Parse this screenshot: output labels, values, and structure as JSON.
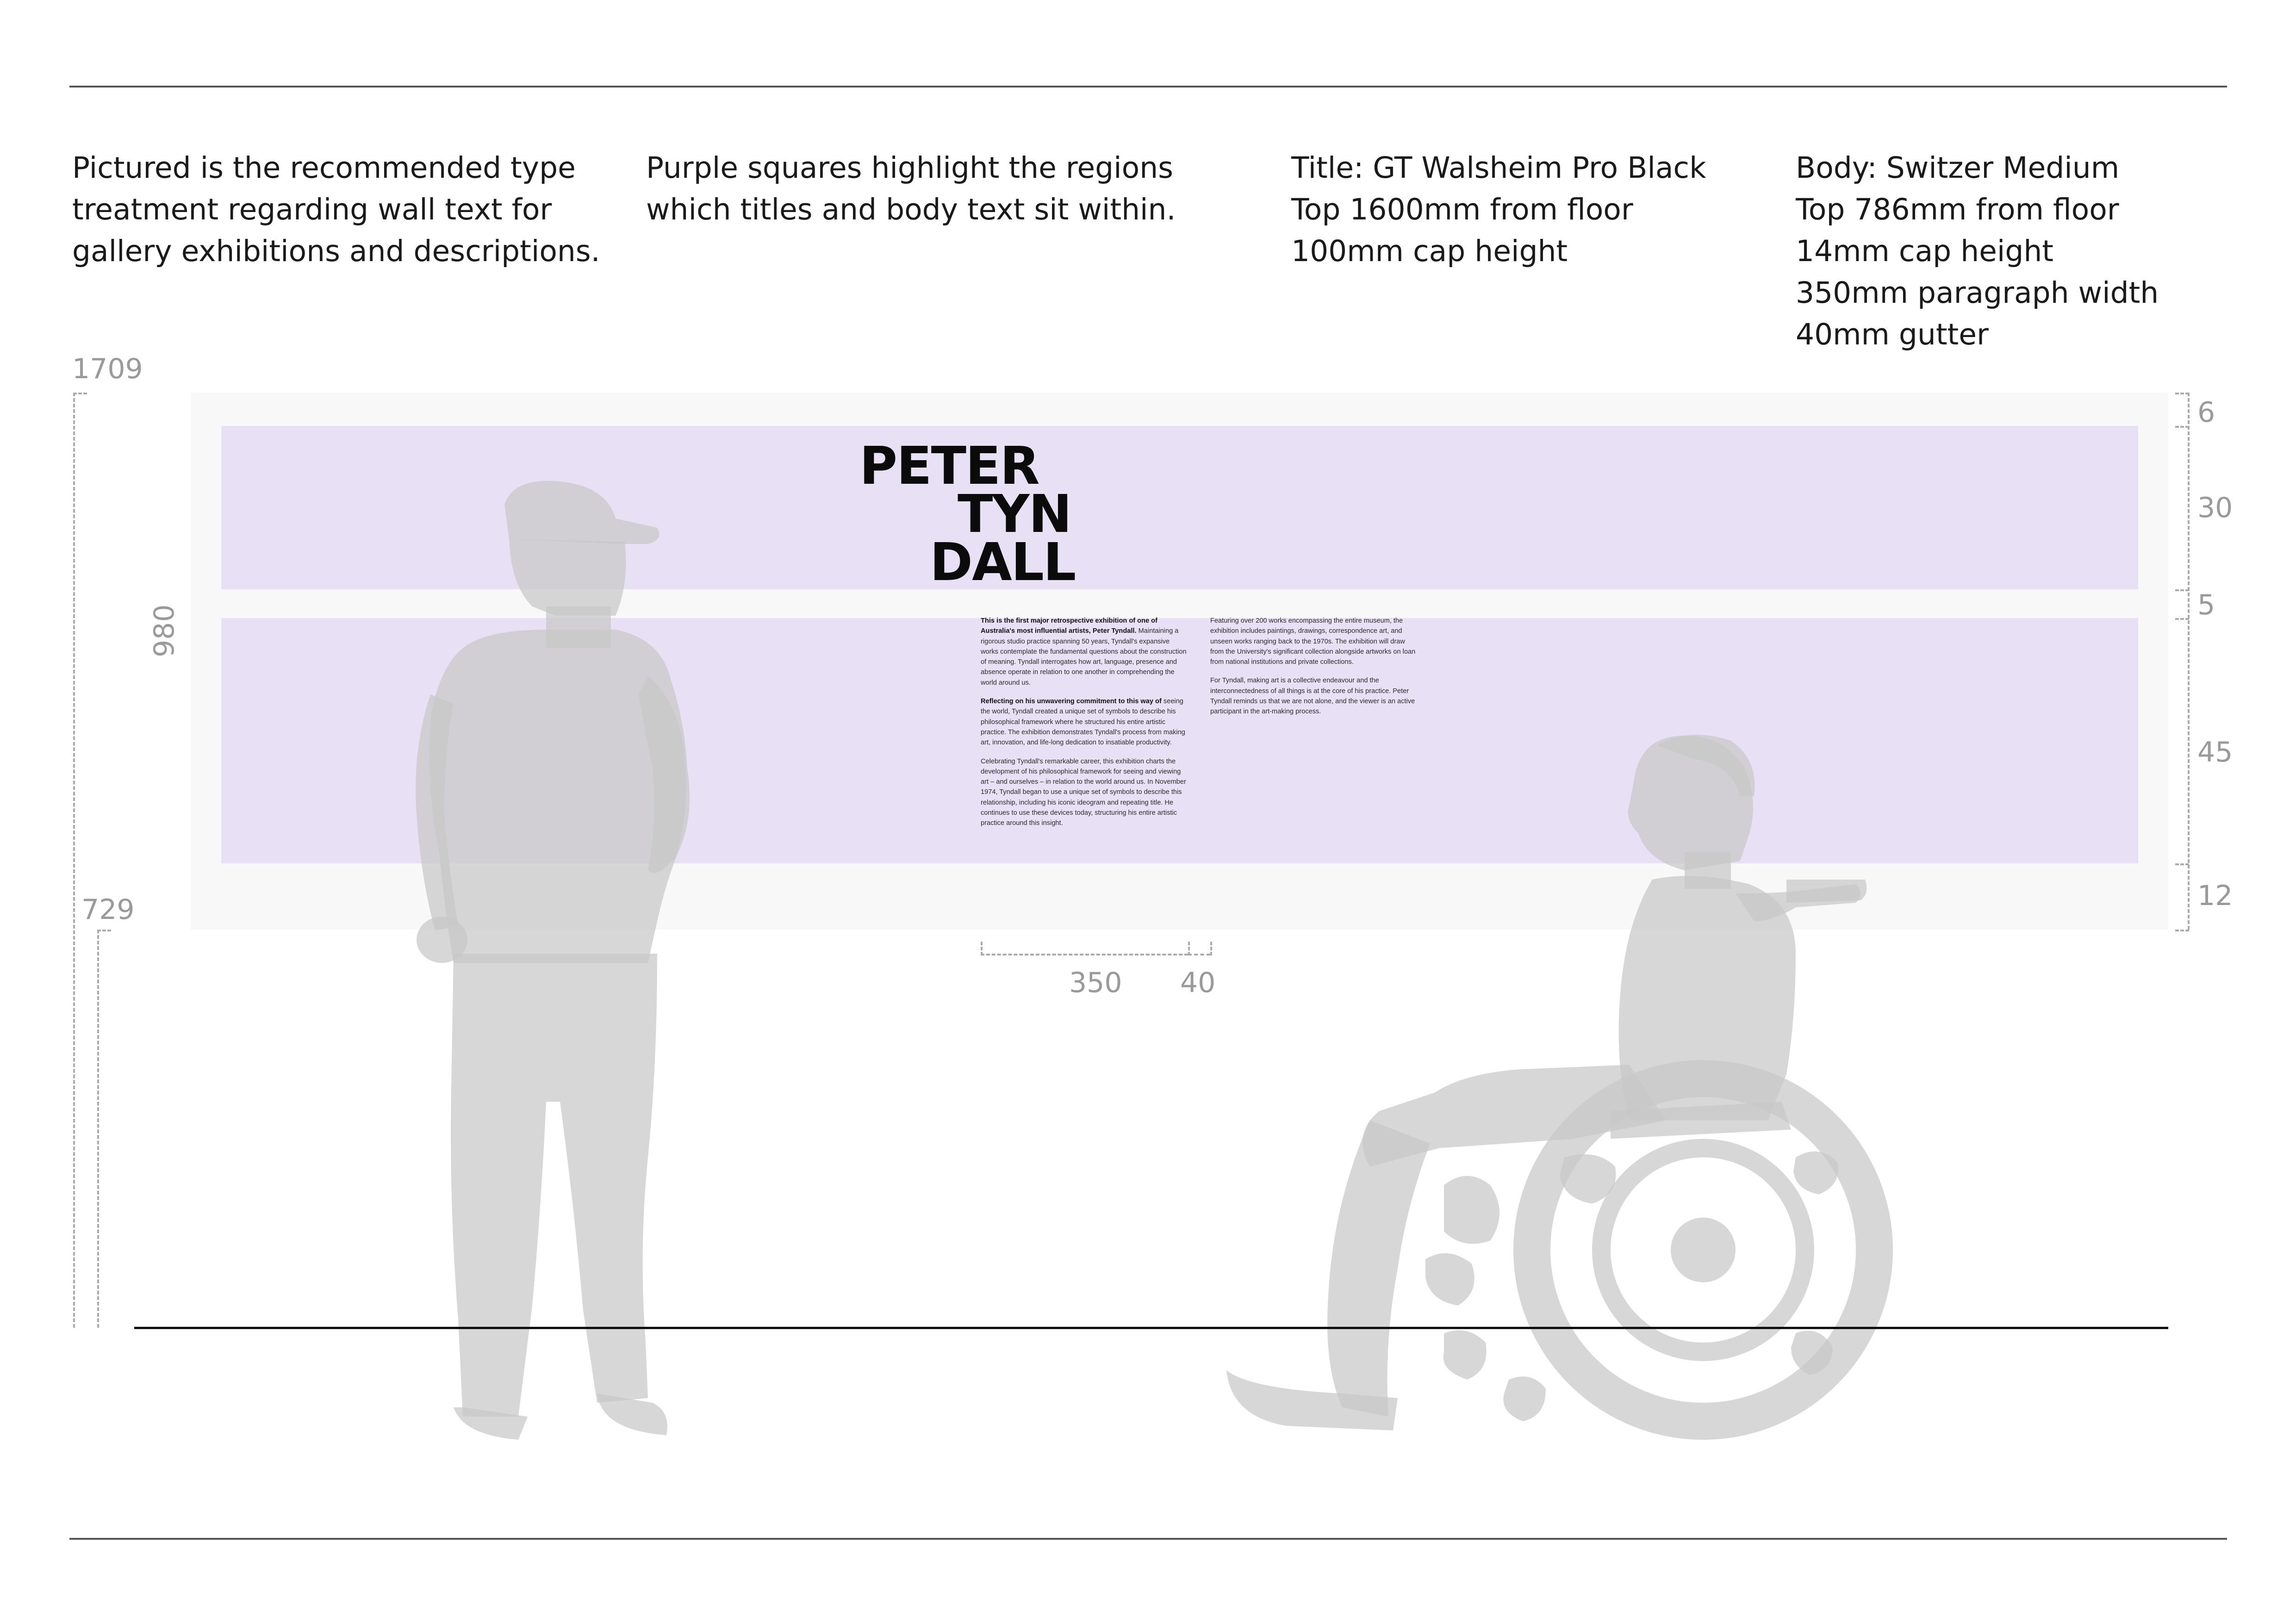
{
  "notes": [
    [
      "Pictured is the recommended type",
      "treatment regarding wall text for",
      "gallery exhibitions and descriptions."
    ],
    [
      "Purple squares highlight the regions",
      "which titles and body text sit within."
    ],
    [
      "Title: GT Walsheim Pro Black",
      "Top 1600mm from floor",
      "100mm cap height"
    ],
    [
      "Body: Switzer Medium",
      "Top 786mm from floor",
      "14mm cap height",
      "350mm paragraph width",
      "40mm gutter"
    ]
  ],
  "dimensions": {
    "left_top": "1709",
    "left_height": "980",
    "left_bottom": "729",
    "right": [
      "6",
      "30",
      "5",
      "45",
      "12"
    ],
    "column_width": "350",
    "gutter": "40"
  },
  "wall_title": [
    "PETER",
    "TYN",
    "DALL"
  ],
  "body_columns": [
    [
      {
        "lead": "This is the first major retrospective exhibition of one of Australia's most influential artists, Peter Tyndall.",
        "text": "Maintaining a rigorous studio practice spanning 50 years, Tyndall's expansive works contemplate the fundamental questions about the construction of meaning. Tyndall interrogates how art, language, presence and absence operate in relation to one another in comprehending the world around us."
      },
      {
        "lead": "Reflecting on his unwavering commitment to this way of",
        "text": "seeing the world, Tyndall created a unique set of symbols to describe his philosophical framework where he structured his entire artistic practice. The exhibition demonstrates Tyndall's process from making art, innovation, and life-long dedication to insatiable productivity."
      },
      {
        "lead": "",
        "text": "Celebrating Tyndall's remarkable career, this exhibition charts the development of his philosophical framework for seeing and viewing art – and ourselves – in relation to the world around us. In November 1974, Tyndall began to use a unique set of symbols to describe this relationship, including his iconic ideogram and repeating title. He continues to use these devices today, structuring his entire artistic practice around this insight."
      }
    ],
    [
      {
        "lead": "",
        "text": "Featuring over 200 works encompassing the entire museum, the exhibition includes paintings, drawings, correspondence art, and unseen works ranging back to the 1970s. The exhibition will draw from the University's significant collection alongside artworks on loan from national institutions and private collections."
      },
      {
        "lead": "",
        "text": "For Tyndall, making art is a collective endeavour and the interconnectedness of all things is at the core of his practice. Peter Tyndall reminds us that we are not alone, and the viewer is an active participant in the art-making process."
      }
    ]
  ],
  "colors": {
    "region": "#e8e0f5",
    "wall": "#f8f8f8",
    "silhouette": "#c8c8c8",
    "dimension": "#9a9a9a"
  },
  "icons": [
    "standing-person-silhouette",
    "wheelchair-user-silhouette"
  ]
}
